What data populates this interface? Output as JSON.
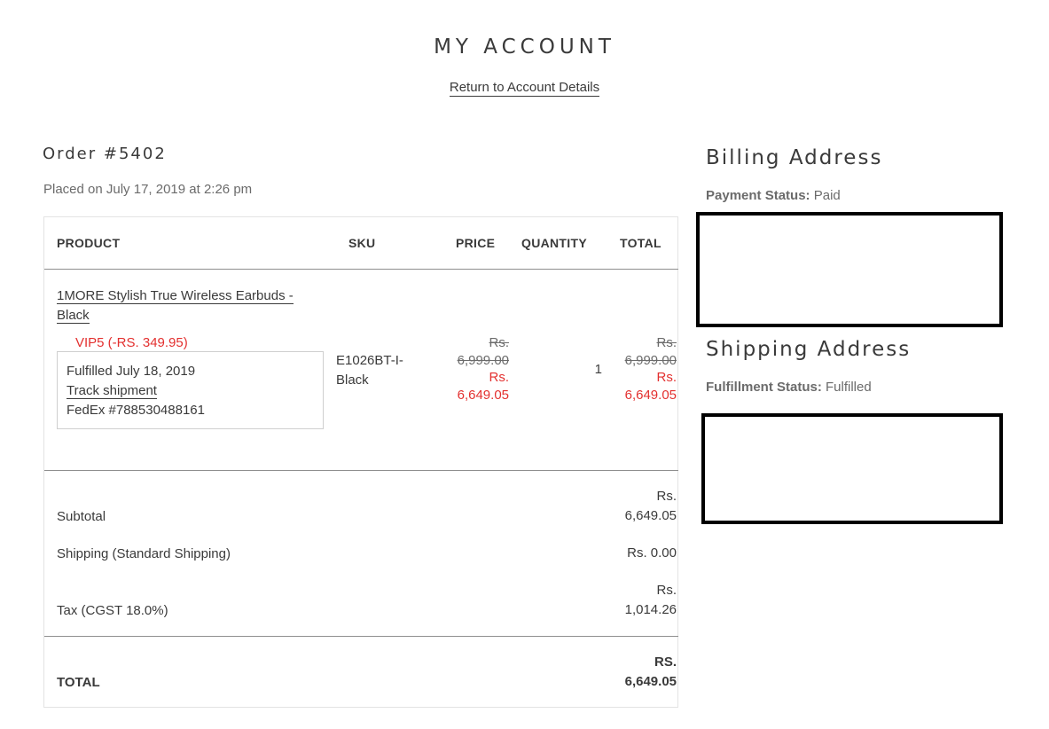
{
  "header": {
    "title": "MY ACCOUNT",
    "return_link": "Return to Account Details"
  },
  "order": {
    "heading": "Order #5402",
    "placed_on": "Placed on July 17, 2019 at 2:26 pm",
    "columns": {
      "product": "PRODUCT",
      "sku": "SKU",
      "price": "PRICE",
      "quantity": "QUANTITY",
      "total": "TOTAL"
    },
    "item": {
      "name_line1": "1MORE Stylish True Wireless Earbuds -",
      "name_line2": "Black",
      "discount": "VIP5 (-RS. 349.95)",
      "fulfilled": "Fulfilled July 18, 2019",
      "track_link": "Track shipment",
      "carrier": "FedEx #788530488161",
      "sku_line1": "E1026BT-I-",
      "sku_line2": "Black",
      "original_price_currency": "Rs.",
      "original_price_amount": "6,999.00",
      "price_currency": "Rs.",
      "price_amount": "6,649.05",
      "quantity": "1",
      "original_total_currency": "Rs.",
      "original_total_amount": "6,999.00",
      "total_currency": "Rs.",
      "total_amount": "6,649.05"
    },
    "summary": {
      "subtotal_label": "Subtotal",
      "subtotal_currency": "Rs.",
      "subtotal_amount": "6,649.05",
      "shipping_label": "Shipping (Standard Shipping)",
      "shipping_value": "Rs. 0.00",
      "tax_label": "Tax (CGST 18.0%)",
      "tax_currency": "Rs.",
      "tax_amount": "1,014.26",
      "total_label": "TOTAL",
      "total_currency": "RS.",
      "total_amount": "6,649.05"
    }
  },
  "billing": {
    "heading": "Billing Address",
    "status_label": "Payment Status:",
    "status_value": "Paid"
  },
  "shipping": {
    "heading": "Shipping Address",
    "status_label": "Fulfillment Status:",
    "status_value": "Fulfilled"
  },
  "colors": {
    "text": "#3a3a3a",
    "muted": "#6b6b6b",
    "discount_red": "#e3302f",
    "redaction_border": "#000000"
  }
}
